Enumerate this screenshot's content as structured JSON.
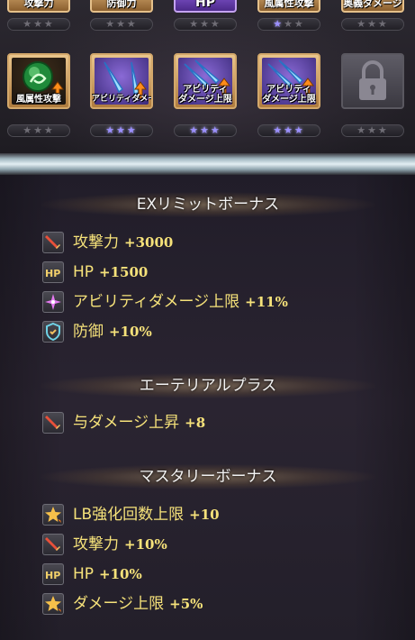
{
  "top_row": [
    {
      "label": "攻撃力",
      "stars": 3
    },
    {
      "label": "防御力",
      "stars": 3
    },
    {
      "label": "HP",
      "stars": 3
    },
    {
      "label": "風属性攻撃",
      "stars": 1
    },
    {
      "label": "奥義ダメージ",
      "stars": 3
    }
  ],
  "second_row": [
    {
      "label": "風属性攻撃",
      "stars_lit": 0,
      "icon": "green-orb-icon"
    },
    {
      "label": "アビリティダメージ",
      "stars_lit": 3,
      "icon": "blue-swords-icon"
    },
    {
      "label": "アビリティ\nダメージ上限",
      "stars_lit": 3,
      "icon": "blue-swords-icon"
    },
    {
      "label": "アビリティ\nダメージ上限",
      "stars_lit": 3,
      "icon": "blue-swords-icon"
    },
    {
      "label": "",
      "stars_lit": 0,
      "icon": "padlock-icon",
      "locked": true
    }
  ],
  "sections": {
    "ex_limit": {
      "title": "EXリミットボーナス",
      "items": [
        {
          "icon": "attack-sword-icon",
          "name": "攻撃力",
          "value": "+3000"
        },
        {
          "icon": "hp-icon",
          "name": "HP",
          "value": "+1500"
        },
        {
          "icon": "ability-spark-icon",
          "name": "アビリティダメージ上限",
          "value": "+11%"
        },
        {
          "icon": "defense-shield-icon",
          "name": "防御",
          "value": "+10%"
        }
      ]
    },
    "aetherial": {
      "title": "エーテリアルプラス",
      "items": [
        {
          "icon": "attack-sword-icon",
          "name": "与ダメージ上昇",
          "value": "+8"
        }
      ]
    },
    "mastery": {
      "title": "マスタリーボーナス",
      "items": [
        {
          "icon": "burst-star-icon",
          "name": "LB強化回数上限",
          "value": "+10"
        },
        {
          "icon": "attack-sword-icon",
          "name": "攻撃力",
          "value": "+10%"
        },
        {
          "icon": "hp-icon",
          "name": "HP",
          "value": "+10%"
        },
        {
          "icon": "burst-star-icon",
          "name": "ダメージ上限",
          "value": "+5%"
        }
      ]
    }
  },
  "colors": {
    "ex_limit_text": "#f6e27a",
    "aetherial_text": "#9bd24a",
    "mastery_text": "#e3a4f2",
    "star_lit": "#9c90ff"
  }
}
